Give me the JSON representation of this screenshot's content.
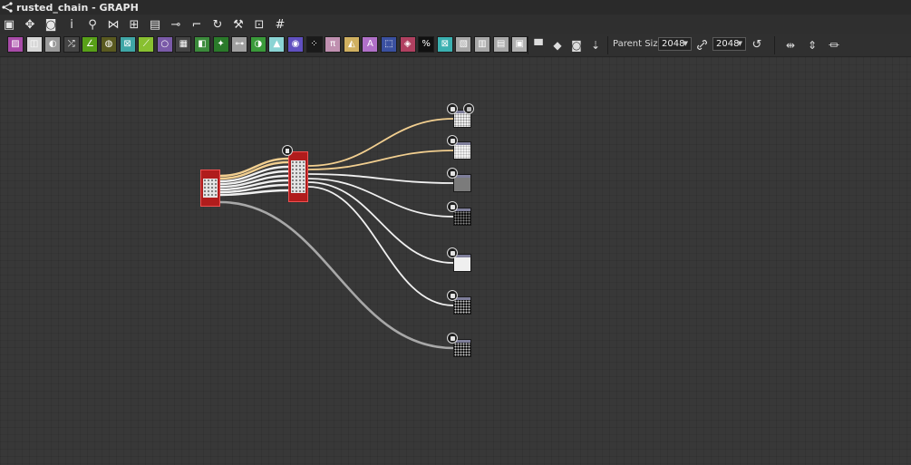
{
  "window": {
    "title": "rusted_chain - GRAPH",
    "title_icon": "graph-icon"
  },
  "toolbar1": {
    "items": [
      {
        "name": "frame-all-icon",
        "glyph": "▣"
      },
      {
        "name": "pan-icon",
        "glyph": "✥"
      },
      {
        "name": "camera-icon",
        "glyph": "◙"
      },
      {
        "name": "info-icon",
        "glyph": "i"
      },
      {
        "name": "zoom-icon",
        "glyph": "⚲"
      },
      {
        "name": "connect-icon",
        "glyph": "⋈"
      },
      {
        "name": "layout-icon",
        "glyph": "⊞"
      },
      {
        "name": "comment-frame-icon",
        "glyph": "▤"
      },
      {
        "name": "link-mode-icon",
        "glyph": "⊸"
      },
      {
        "name": "straight-link-icon",
        "glyph": "⌐"
      },
      {
        "name": "refresh-icon",
        "glyph": "↻"
      },
      {
        "name": "tools-icon",
        "glyph": "⚒"
      },
      {
        "name": "preview-icon",
        "glyph": "⊡"
      },
      {
        "name": "crop-icon",
        "glyph": "#"
      }
    ]
  },
  "toolbar2": {
    "atoms": [
      {
        "name": "bitmap-atom-icon",
        "color": "#a84ba8",
        "glyph": "▨"
      },
      {
        "name": "blend-atom-icon",
        "color": "#d7d7d7",
        "glyph": "◫"
      },
      {
        "name": "levels-atom-icon",
        "color": "#9a9a9a",
        "glyph": "◐"
      },
      {
        "name": "shuffle-atom-icon",
        "color": "#444444",
        "glyph": "⤮"
      },
      {
        "name": "curve-atom-icon",
        "color": "#58a018",
        "glyph": "∠"
      },
      {
        "name": "hsl-atom-icon",
        "color": "#5a5a20",
        "glyph": "◍"
      },
      {
        "name": "transform-atom-icon",
        "color": "#3fa6a6",
        "glyph": "⊠"
      },
      {
        "name": "gradient-atom-icon",
        "color": "#88c030",
        "glyph": "⟋"
      },
      {
        "name": "circle-atom-icon",
        "color": "#7a5aa8",
        "glyph": "○"
      },
      {
        "name": "tile-atom-icon",
        "color": "#444444",
        "glyph": "▦"
      },
      {
        "name": "color-fill-atom-icon",
        "color": "#3b8a3b",
        "glyph": "◧"
      },
      {
        "name": "warp-atom-icon",
        "color": "#2a7a2a",
        "glyph": "✦"
      },
      {
        "name": "channels-atom-icon",
        "color": "#a0a0a0",
        "glyph": "⊶"
      },
      {
        "name": "uniform-color-atom-icon",
        "color": "#3a9a3a",
        "glyph": "◑"
      },
      {
        "name": "histogram-atom-icon",
        "color": "#8ad4d4",
        "glyph": "▲"
      },
      {
        "name": "color-wheel-atom-icon",
        "color": "#6050c0",
        "glyph": "◉"
      },
      {
        "name": "fx-map-atom-icon",
        "color": "#1a1a1a",
        "glyph": "⁘"
      },
      {
        "name": "pixel-processor-atom-icon",
        "color": "#c090b0",
        "glyph": "π"
      },
      {
        "name": "normal-atom-icon",
        "color": "#d0b060",
        "glyph": "◭"
      },
      {
        "name": "text-atom-icon",
        "color": "#b070c8",
        "glyph": "A"
      },
      {
        "name": "input-atom-icon",
        "color": "#3a50a0",
        "glyph": "⬚"
      },
      {
        "name": "fill-atom-icon",
        "color": "#b04060",
        "glyph": "◈"
      },
      {
        "name": "value-atom-icon",
        "color": "#101010",
        "glyph": "%"
      },
      {
        "name": "output-atom-icon",
        "color": "#3ab0b0",
        "glyph": "⊠"
      },
      {
        "name": "node-a-atom-icon",
        "color": "#a8a8a8",
        "glyph": "▧"
      },
      {
        "name": "node-b-atom-icon",
        "color": "#a8a8a8",
        "glyph": "▥"
      },
      {
        "name": "node-c-atom-icon",
        "color": "#a8a8a8",
        "glyph": "▤"
      },
      {
        "name": "node-d-atom-icon",
        "color": "#b0b0b0",
        "glyph": "▣"
      }
    ],
    "tools": [
      {
        "name": "comment-icon",
        "glyph": "▀"
      },
      {
        "name": "pin-link-icon",
        "glyph": "◆"
      },
      {
        "name": "frame-node-icon",
        "glyph": "◙"
      },
      {
        "name": "pin-icon",
        "glyph": "⇣"
      }
    ],
    "parent_size_label": "Parent Size:",
    "size_width": "2048",
    "size_height": "2048",
    "link_icon": "link-icon",
    "reset_icon": "reset-icon",
    "right_icons": [
      {
        "name": "align-horizontal-icon",
        "glyph": "⇹"
      },
      {
        "name": "align-vertical-icon",
        "glyph": "⇕"
      },
      {
        "name": "distribute-icon",
        "glyph": "⏛"
      }
    ]
  },
  "graph": {
    "colors": {
      "wire_input": "#f2cf90",
      "wire_output": "#f0f0f0",
      "wire_long": "#a8a8a8",
      "node_red": "#b01c1c"
    }
  }
}
